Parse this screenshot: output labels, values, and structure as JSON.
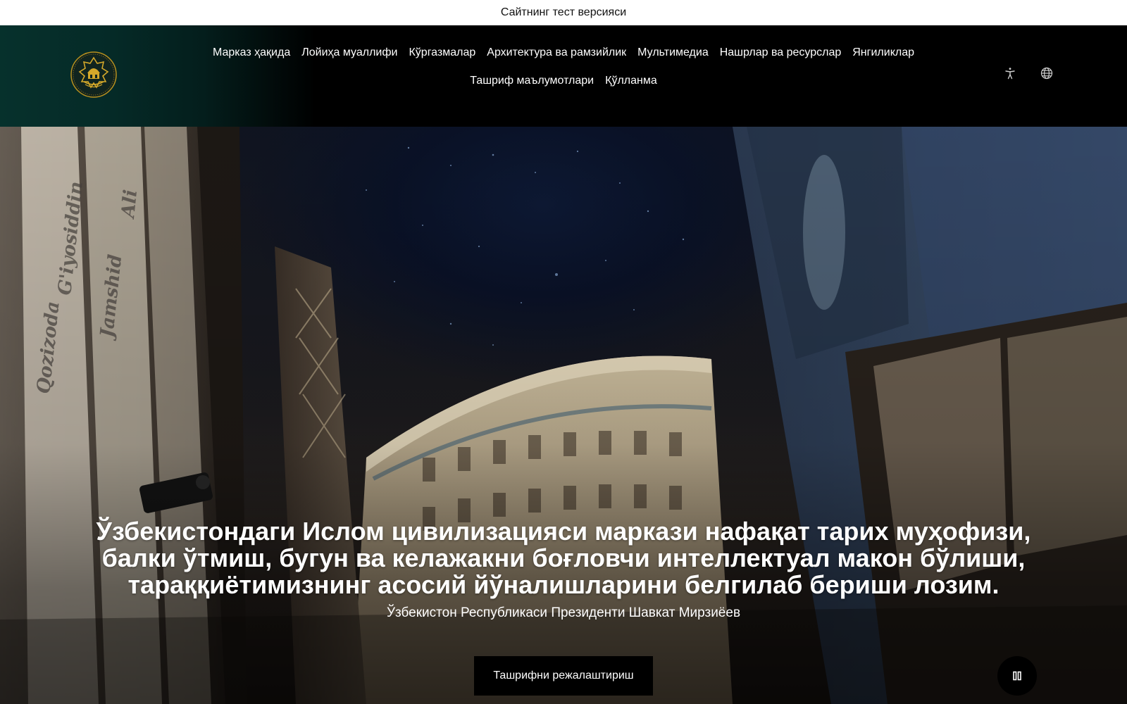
{
  "banner": {
    "text": "Сайтнинг тест версияси"
  },
  "header": {
    "nav": [
      {
        "label": "Марказ ҳақида"
      },
      {
        "label": "Лойиҳа муаллифи"
      },
      {
        "label": "Кўргазмалар"
      },
      {
        "label": "Архитектура ва рамзийлик"
      },
      {
        "label": "Мультимедиа"
      },
      {
        "label": "Нашрлар ва ресурслар"
      },
      {
        "label": "Янгиликлар"
      },
      {
        "label": "Ташриф маълумотлари"
      },
      {
        "label": "Қўлланма"
      }
    ],
    "icons": {
      "accessibility": "accessibility-icon",
      "language": "globe-icon"
    }
  },
  "hero": {
    "quote": "Ўзбекистондаги Ислом цивилизацияси маркази нафақат тарих муҳофизи, балки ўтмиш, бугун ва келажакни боғловчи интеллектуал макон бўлиши, тараққиётимизнинг асосий йўналишларини белгилаб бериши лозим.",
    "author": "Ўзбекистон Республикаси Президенти Шавкат Мирзиёев",
    "cta_label": "Ташрифни режалаштириш",
    "pause_icon": "pause-icon"
  },
  "colors": {
    "header_accent": "#06312c",
    "logo_gold": "#d4a82a",
    "button": "#000000"
  }
}
